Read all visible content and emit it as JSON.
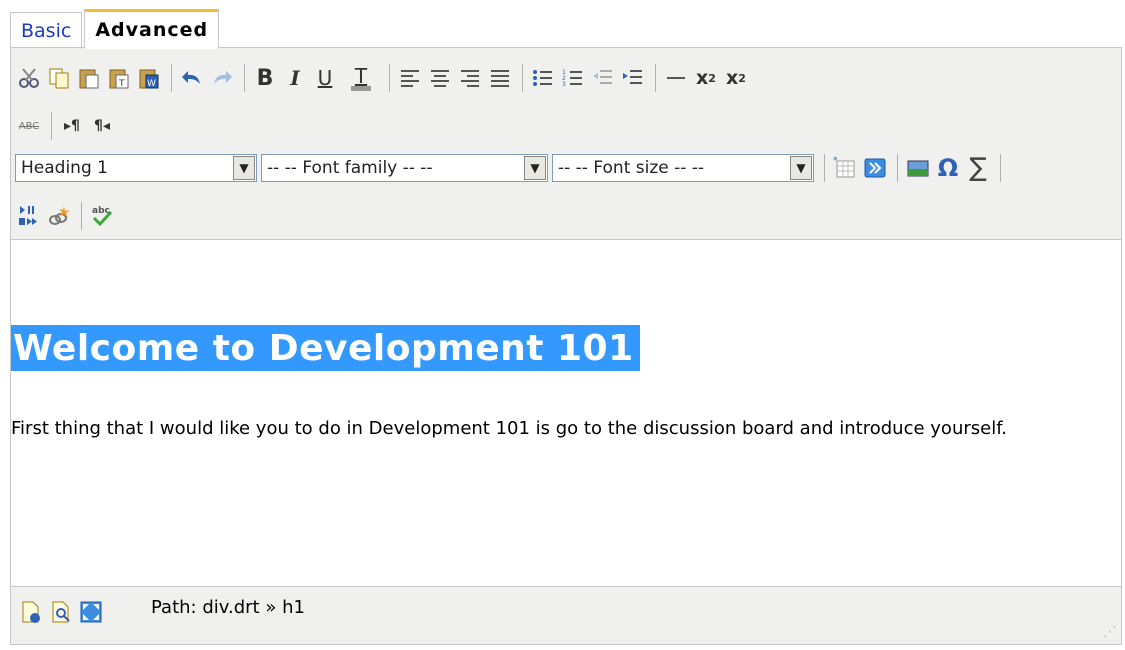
{
  "tabs": {
    "basic": "Basic",
    "advanced": "Advanced"
  },
  "toolbar": {
    "block_format": "Heading 1",
    "font_family": "-- -- Font family -- --",
    "font_size": "-- -- Font size -- --"
  },
  "content": {
    "heading": "Welcome to Development 101",
    "paragraph": "First thing that I would like you to do in Development 101 is go to the discussion board and introduce yourself."
  },
  "status": {
    "path": "Path: div.drt » h1"
  },
  "colors": {
    "selection": "#3399ff",
    "active_tab_accent": "#f5bc38",
    "toolbar_bg": "#f0f0ee"
  }
}
